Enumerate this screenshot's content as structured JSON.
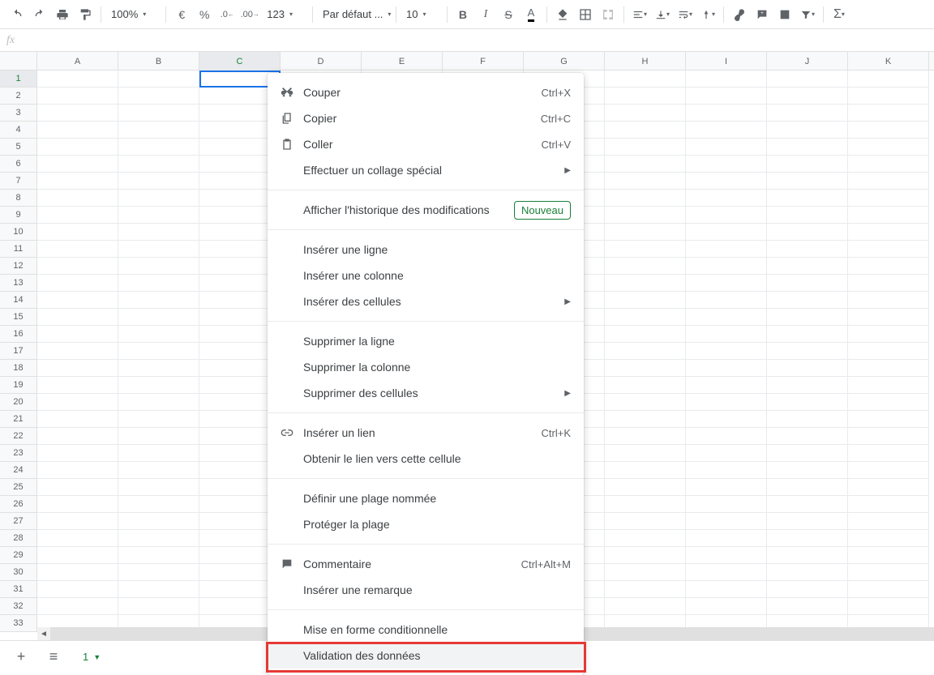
{
  "toolbar": {
    "zoom": "100%",
    "font": "Par défaut ...",
    "fontSize": "10",
    "numberFormat": "123"
  },
  "columns": [
    "A",
    "B",
    "C",
    "D",
    "E",
    "F",
    "G",
    "H",
    "I",
    "J",
    "K"
  ],
  "rows": [
    "1",
    "2",
    "3",
    "4",
    "5",
    "6",
    "7",
    "8",
    "9",
    "10",
    "11",
    "12",
    "13",
    "14",
    "15",
    "16",
    "17",
    "18",
    "19",
    "20",
    "21",
    "22",
    "23",
    "24",
    "25",
    "26",
    "27",
    "28",
    "29",
    "30",
    "31",
    "32",
    "33"
  ],
  "activeCell": "C1",
  "contextMenu": {
    "cut": {
      "label": "Couper",
      "shortcut": "Ctrl+X"
    },
    "copy": {
      "label": "Copier",
      "shortcut": "Ctrl+C"
    },
    "paste": {
      "label": "Coller",
      "shortcut": "Ctrl+V"
    },
    "pasteSpecial": {
      "label": "Effectuer un collage spécial"
    },
    "showHistory": {
      "label": "Afficher l'historique des modifications",
      "badge": "Nouveau"
    },
    "insertRow": {
      "label": "Insérer une ligne"
    },
    "insertCol": {
      "label": "Insérer une colonne"
    },
    "insertCells": {
      "label": "Insérer des cellules"
    },
    "deleteRow": {
      "label": "Supprimer la ligne"
    },
    "deleteCol": {
      "label": "Supprimer la colonne"
    },
    "deleteCells": {
      "label": "Supprimer des cellules"
    },
    "insertLink": {
      "label": "Insérer un lien",
      "shortcut": "Ctrl+K"
    },
    "getLink": {
      "label": "Obtenir le lien vers cette cellule"
    },
    "namedRange": {
      "label": "Définir une plage nommée"
    },
    "protectRange": {
      "label": "Protéger la plage"
    },
    "comment": {
      "label": "Commentaire",
      "shortcut": "Ctrl+Alt+M"
    },
    "note": {
      "label": "Insérer une remarque"
    },
    "conditional": {
      "label": "Mise en forme conditionnelle"
    },
    "validation": {
      "label": "Validation des données"
    }
  },
  "sheetTab": "1"
}
